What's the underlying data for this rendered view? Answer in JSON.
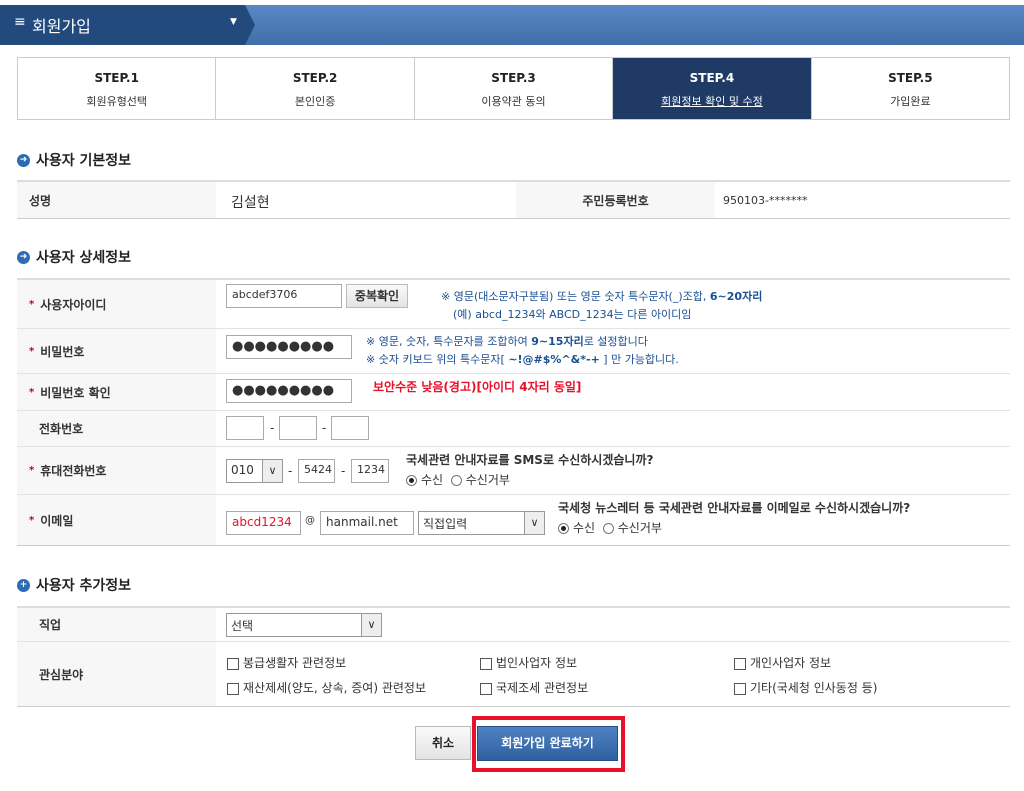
{
  "header": {
    "title": "회원가입",
    "menu_icon": "hamburger-icon",
    "caret_icon": "caret-down-icon"
  },
  "steps": [
    {
      "num": "STEP.1",
      "label": "회원유형선택"
    },
    {
      "num": "STEP.2",
      "label": "본인인증"
    },
    {
      "num": "STEP.3",
      "label": "이용약관 동의"
    },
    {
      "num": "STEP.4",
      "label": "회원정보 확인 및 수정",
      "active": true
    },
    {
      "num": "STEP.5",
      "label": "가입완료"
    }
  ],
  "basic": {
    "title": "사용자 기본정보",
    "name_label": "성명",
    "name_value": "김설현",
    "rrn_label": "주민등록번호",
    "rrn_value": "950103-*******"
  },
  "detail": {
    "title": "사용자 상세정보",
    "id_label": "사용자아이디",
    "id_value": "abcdef3706",
    "dup_check": "중복확인",
    "id_note1": "※ 영문(대소문자구분됨) 또는 영문 숫자 특수문자(_)조합, ",
    "id_note1_bold": "6~20자리",
    "id_note2": "(예) abcd_1234와  ABCD_1234는 다른 아이디임",
    "pw_label": "비밀번호",
    "pw_value": "●●●●●●●●●",
    "pw_note1a": "※ 영문, 숫자, 특수문자를 조합하여 ",
    "pw_note1b": "9~15자리",
    "pw_note1c": "로 설정합니다",
    "pw_note2a": "※ 숫자 키보드 위의 특수문자[ ",
    "pw_note2b": "~!@#$%^&*-+",
    "pw_note2c": " ] 만 가능합니다.",
    "pwc_label": "비밀번호 확인",
    "pwc_value": "●●●●●●●●●",
    "pwc_warning": "보안수준 낮음(경고)[아이디 4자리 동일]",
    "phone_label": "전화번호",
    "dash": "-",
    "mobile_label": "휴대전화번호",
    "mobile_prefix": "010",
    "mobile_mid": "5424",
    "mobile_last": "1234",
    "sms_q": "국세관련 안내자료를 SMS로 수신하시겠습니까?",
    "receive": "수신",
    "reject": "수신거부",
    "email_label": "이메일",
    "email_id": "abcd1234",
    "at": "@",
    "email_domain": "hanmail.net",
    "email_select": "직접입력",
    "email_q": "국세청 뉴스레터 등 국세관련 안내자료를 이메일로 수신하시겠습니까?"
  },
  "extra": {
    "title": "사용자 추가정보",
    "job_label": "직업",
    "job_select": "선택",
    "interest_label": "관심분야",
    "interests": [
      "봉급생활자 관련정보",
      "법인사업자 정보",
      "개인사업자 정보",
      "재산제세(양도, 상속, 증여) 관련정보",
      "국제조세 관련정보",
      "기타(국세청 인사동정 등)"
    ]
  },
  "buttons": {
    "cancel": "취소",
    "submit": "회원가입 완료하기"
  },
  "colors": {
    "accent": "#1f3a64",
    "highlight": "#e8102a",
    "warning": "#e8102a"
  }
}
